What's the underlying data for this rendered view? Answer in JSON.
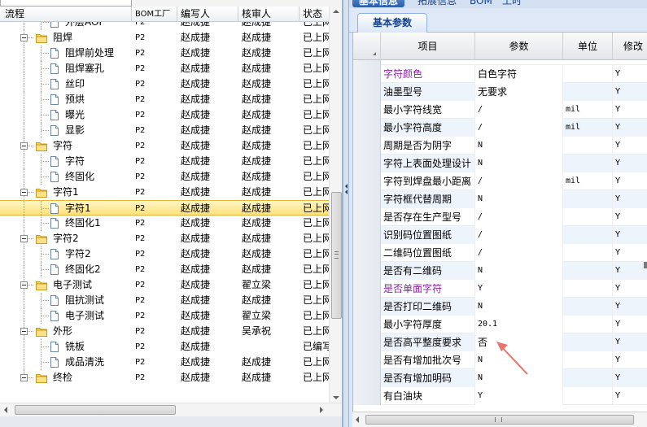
{
  "left_tree": {
    "columns": {
      "flow": "流程",
      "bom": "BOM工厂",
      "editor": "编写人",
      "reviewer": "核审人",
      "status": "状态"
    },
    "rows": [
      {
        "level": 2,
        "type": "file",
        "label": "外层AOI",
        "bom": "P2",
        "editor": "赵成捷",
        "reviewer": "赵成捷",
        "status": "已上网"
      },
      {
        "level": 1,
        "type": "folder",
        "label": "阻焊",
        "bom": "P2",
        "editor": "赵成捷",
        "reviewer": "赵成捷",
        "status": "已上网"
      },
      {
        "level": 2,
        "type": "file",
        "label": "阻焊前处理",
        "bom": "P2",
        "editor": "赵成捷",
        "reviewer": "赵成捷",
        "status": "已上网"
      },
      {
        "level": 2,
        "type": "file",
        "label": "阻焊塞孔",
        "bom": "P2",
        "editor": "赵成捷",
        "reviewer": "赵成捷",
        "status": "已上网"
      },
      {
        "level": 2,
        "type": "file",
        "label": "丝印",
        "bom": "P2",
        "editor": "赵成捷",
        "reviewer": "赵成捷",
        "status": "已上网"
      },
      {
        "level": 2,
        "type": "file",
        "label": "预烘",
        "bom": "P2",
        "editor": "赵成捷",
        "reviewer": "赵成捷",
        "status": "已上网"
      },
      {
        "level": 2,
        "type": "file",
        "label": "曝光",
        "bom": "P2",
        "editor": "赵成捷",
        "reviewer": "赵成捷",
        "status": "已上网"
      },
      {
        "level": 2,
        "type": "file",
        "label": "显影",
        "bom": "P2",
        "editor": "赵成捷",
        "reviewer": "赵成捷",
        "status": "已上网"
      },
      {
        "level": 1,
        "type": "folder",
        "label": "字符",
        "bom": "P2",
        "editor": "赵成捷",
        "reviewer": "赵成捷",
        "status": "已上网"
      },
      {
        "level": 2,
        "type": "file",
        "label": "字符",
        "bom": "P2",
        "editor": "赵成捷",
        "reviewer": "赵成捷",
        "status": "已上网"
      },
      {
        "level": 2,
        "type": "file",
        "label": "终固化",
        "bom": "P2",
        "editor": "赵成捷",
        "reviewer": "赵成捷",
        "status": "已上网"
      },
      {
        "level": 1,
        "type": "folder",
        "label": "字符1",
        "bom": "P2",
        "editor": "赵成捷",
        "reviewer": "赵成捷",
        "status": "已上网"
      },
      {
        "level": 2,
        "type": "file",
        "label": "字符1",
        "bom": "P2",
        "editor": "赵成捷",
        "reviewer": "赵成捷",
        "status": "已上网",
        "selected": true
      },
      {
        "level": 2,
        "type": "file",
        "label": "终固化1",
        "bom": "P2",
        "editor": "赵成捷",
        "reviewer": "赵成捷",
        "status": "已上网"
      },
      {
        "level": 1,
        "type": "folder",
        "label": "字符2",
        "bom": "P2",
        "editor": "赵成捷",
        "reviewer": "赵成捷",
        "status": "已上网"
      },
      {
        "level": 2,
        "type": "file",
        "label": "字符2",
        "bom": "P2",
        "editor": "赵成捷",
        "reviewer": "赵成捷",
        "status": "已上网"
      },
      {
        "level": 2,
        "type": "file",
        "label": "终固化2",
        "bom": "P2",
        "editor": "赵成捷",
        "reviewer": "赵成捷",
        "status": "已上网"
      },
      {
        "level": 1,
        "type": "folder",
        "label": "电子测试",
        "bom": "P2",
        "editor": "赵成捷",
        "reviewer": "翟立梁",
        "status": "已上网"
      },
      {
        "level": 2,
        "type": "file",
        "label": "阻抗测试",
        "bom": "P2",
        "editor": "赵成捷",
        "reviewer": "赵成捷",
        "status": "已上网"
      },
      {
        "level": 2,
        "type": "file",
        "label": "电子测试",
        "bom": "P2",
        "editor": "赵成捷",
        "reviewer": "翟立梁",
        "status": "已上网"
      },
      {
        "level": 1,
        "type": "folder",
        "label": "外形",
        "bom": "P2",
        "editor": "赵成捷",
        "reviewer": "吴承祝",
        "status": "已上网"
      },
      {
        "level": 2,
        "type": "file",
        "label": "铣板",
        "bom": "P2",
        "editor": "赵成捷",
        "reviewer": "",
        "status": "已编写"
      },
      {
        "level": 2,
        "type": "file",
        "label": "成品清洗",
        "bom": "P2",
        "editor": "赵成捷",
        "reviewer": "赵成捷",
        "status": "已上网"
      },
      {
        "level": 1,
        "type": "folder",
        "label": "终检",
        "bom": "P2",
        "editor": "赵成捷",
        "reviewer": "赵成捷",
        "status": "已上网"
      }
    ]
  },
  "top_tabs": [
    "基本信息",
    "拓展信息",
    "BOM",
    "工时"
  ],
  "sub_tab": "基本参数",
  "param_grid": {
    "columns": {
      "item": "项目",
      "param": "参数",
      "unit": "单位",
      "mod": "修改"
    },
    "rows": [
      {
        "item": "字符颜色",
        "param": "白色字符",
        "unit": "",
        "mod": "Y",
        "highlight": true
      },
      {
        "item": "油墨型号",
        "param": "无要求",
        "unit": "",
        "mod": "Y"
      },
      {
        "item": "最小字符线宽",
        "param": "/",
        "unit": "mil",
        "mod": "Y"
      },
      {
        "item": "最小字符高度",
        "param": "/",
        "unit": "mil",
        "mod": "Y"
      },
      {
        "item": "周期是否为阴字",
        "param": "N",
        "unit": "",
        "mod": "Y"
      },
      {
        "item": "字符上表面处理设计",
        "param": "N",
        "unit": "",
        "mod": "Y"
      },
      {
        "item": "字符到焊盘最小距离",
        "param": "/",
        "unit": "mil",
        "mod": "Y"
      },
      {
        "item": "字符框代替周期",
        "param": "N",
        "unit": "",
        "mod": "Y"
      },
      {
        "item": "是否存在生产型号",
        "param": "/",
        "unit": "",
        "mod": "Y"
      },
      {
        "item": "识别码位置图纸",
        "param": "/",
        "unit": "",
        "mod": "Y"
      },
      {
        "item": "二维码位置图纸",
        "param": "/",
        "unit": "",
        "mod": "Y"
      },
      {
        "item": "是否有二维码",
        "param": "N",
        "unit": "",
        "mod": "Y"
      },
      {
        "item": "是否单面字符",
        "param": "Y",
        "unit": "",
        "mod": "Y",
        "highlight": true
      },
      {
        "item": "是否打印二维码",
        "param": "N",
        "unit": "",
        "mod": "Y"
      },
      {
        "item": "最小字符厚度",
        "param": "20.1",
        "unit": "",
        "mod": "Y"
      },
      {
        "item": "是否高平整度要求",
        "param": "否",
        "unit": "",
        "mod": "Y"
      },
      {
        "item": "是否有增加批次号",
        "param": "N",
        "unit": "",
        "mod": "Y"
      },
      {
        "item": "是否有增加明码",
        "param": "N",
        "unit": "",
        "mod": "Y"
      },
      {
        "item": "有白油块",
        "param": "Y",
        "unit": "",
        "mod": "Y"
      }
    ]
  },
  "colors": {
    "highlight_item": "#8b1fa8",
    "selection": "#ffe17a",
    "annotation_arrow": "#e8736f",
    "panel_blue": "#dfe8f6"
  },
  "icons": {
    "folder": "folder-icon",
    "file": "document-icon"
  }
}
